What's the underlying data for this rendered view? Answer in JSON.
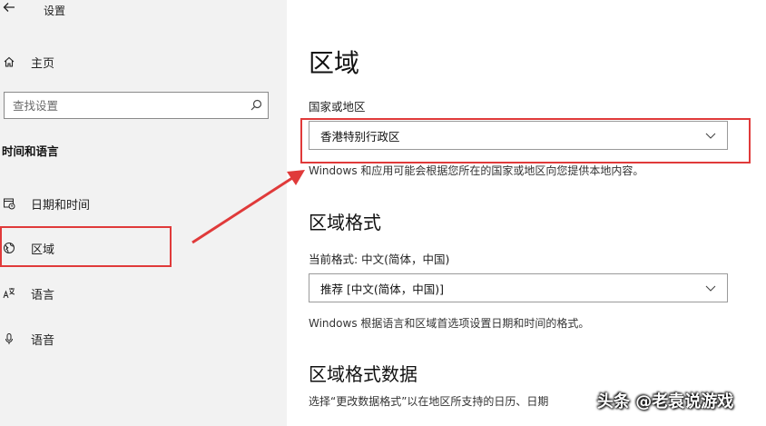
{
  "window": {
    "title": "设置",
    "back_icon": "back-arrow-icon"
  },
  "sidebar": {
    "home_label": "主页",
    "search_placeholder": "查找设置",
    "section_title": "时间和语言",
    "items": [
      {
        "label": "日期和时间",
        "icon": "calendar-clock-icon"
      },
      {
        "label": "区域",
        "icon": "globe-icon"
      },
      {
        "label": "语言",
        "icon": "language-icon"
      },
      {
        "label": "语音",
        "icon": "microphone-icon"
      }
    ]
  },
  "main": {
    "title": "区域",
    "country": {
      "label": "国家或地区",
      "value": "香港特别行政区",
      "description": "Windows 和应用可能会根据您所在的国家或地区向您提供本地内容。"
    },
    "format": {
      "heading": "区域格式",
      "current_label": "当前格式: 中文(简体，中国)",
      "value": "推荐 [中文(简体，中国)]",
      "description": "Windows 根据语言和区域首选项设置日期和时间的格式。"
    },
    "format_data": {
      "heading": "区域格式数据",
      "description": "选择“更改数据格式”以在地区所支持的日历、日期"
    }
  },
  "annotation_color": "#e03a3a",
  "watermark": "头条 @老袁说游戏"
}
